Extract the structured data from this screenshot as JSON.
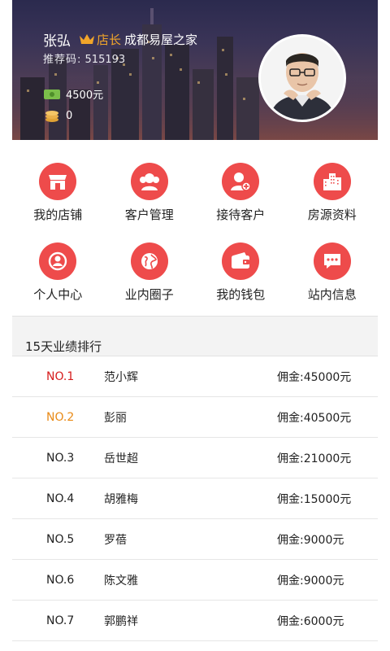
{
  "profile": {
    "name": "张弘",
    "role": "店长",
    "company": "成都易屋之家",
    "referral_label": "推荐码:",
    "referral_code": "515193",
    "balance": "4500元",
    "coins": "0"
  },
  "colors": {
    "accent_red": "#ee4b4b",
    "rank_first": "#d61c1c",
    "rank_second": "#e98a16",
    "role_gold": "#f1a52a"
  },
  "menu": [
    {
      "label": "我的店铺",
      "icon": "store-icon"
    },
    {
      "label": "客户管理",
      "icon": "customers-icon"
    },
    {
      "label": "接待客户",
      "icon": "add-customer-icon"
    },
    {
      "label": "房源资料",
      "icon": "buildings-icon"
    },
    {
      "label": "个人中心",
      "icon": "user-icon"
    },
    {
      "label": "业内圈子",
      "icon": "globe-icon"
    },
    {
      "label": "我的钱包",
      "icon": "wallet-icon"
    },
    {
      "label": "站内信息",
      "icon": "message-icon"
    }
  ],
  "ranking": {
    "title": "15天业绩排行",
    "rows": [
      {
        "rank": "NO.1",
        "name": "范小辉",
        "commission": "佣金:45000元"
      },
      {
        "rank": "NO.2",
        "name": "彭丽",
        "commission": "佣金:40500元"
      },
      {
        "rank": "NO.3",
        "name": "岳世超",
        "commission": "佣金:21000元"
      },
      {
        "rank": "NO.4",
        "name": "胡雅梅",
        "commission": "佣金:15000元"
      },
      {
        "rank": "NO.5",
        "name": "罗蓓",
        "commission": "佣金:9000元"
      },
      {
        "rank": "NO.6",
        "name": "陈文雅",
        "commission": "佣金:9000元"
      },
      {
        "rank": "NO.7",
        "name": "郭鹏祥",
        "commission": "佣金:6000元"
      }
    ]
  }
}
